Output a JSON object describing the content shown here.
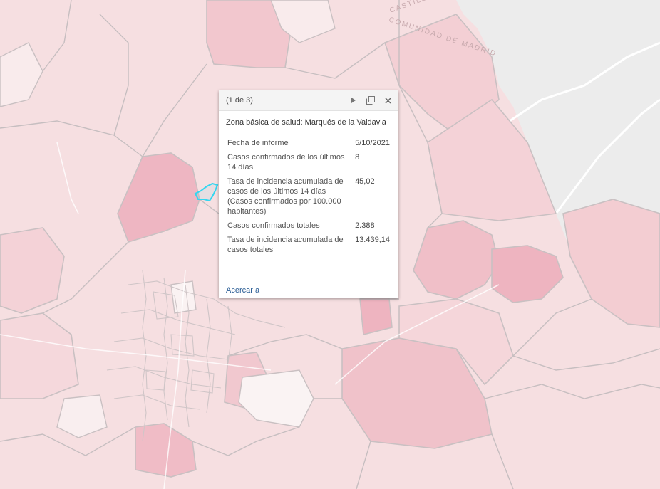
{
  "map": {
    "labels": [
      "CASTILLA",
      "COMUNIDAD DE MADRID"
    ]
  },
  "popup": {
    "pager": "(1 de 3)",
    "title": "Zona básica de salud: Marqués de la Valdavia",
    "rows": [
      {
        "label": "Fecha de informe",
        "value": "5/10/2021"
      },
      {
        "label": "Casos confirmados de los últimos 14 días",
        "value": "8"
      },
      {
        "label": "Tasa de incidencia acumulada de casos de los últimos 14 días (Casos confirmados por 100.000 habitantes)",
        "value": "45,02"
      },
      {
        "label": "Casos confirmados totales",
        "value": "2.388"
      },
      {
        "label": "Tasa de incidencia acumulada de casos totales",
        "value": "13.439,14"
      }
    ],
    "zoom_link": "Acercar a",
    "icons": [
      "next-icon",
      "dock-icon",
      "close-icon"
    ]
  },
  "colors": {
    "choropleth_light": "#f7e1e3",
    "choropleth_mid": "#f0c4cb",
    "choropleth_strong": "#eaa9b6",
    "outside_region": "#eeeeee",
    "selection": "#33d6f0",
    "link": "#2a5d95"
  }
}
